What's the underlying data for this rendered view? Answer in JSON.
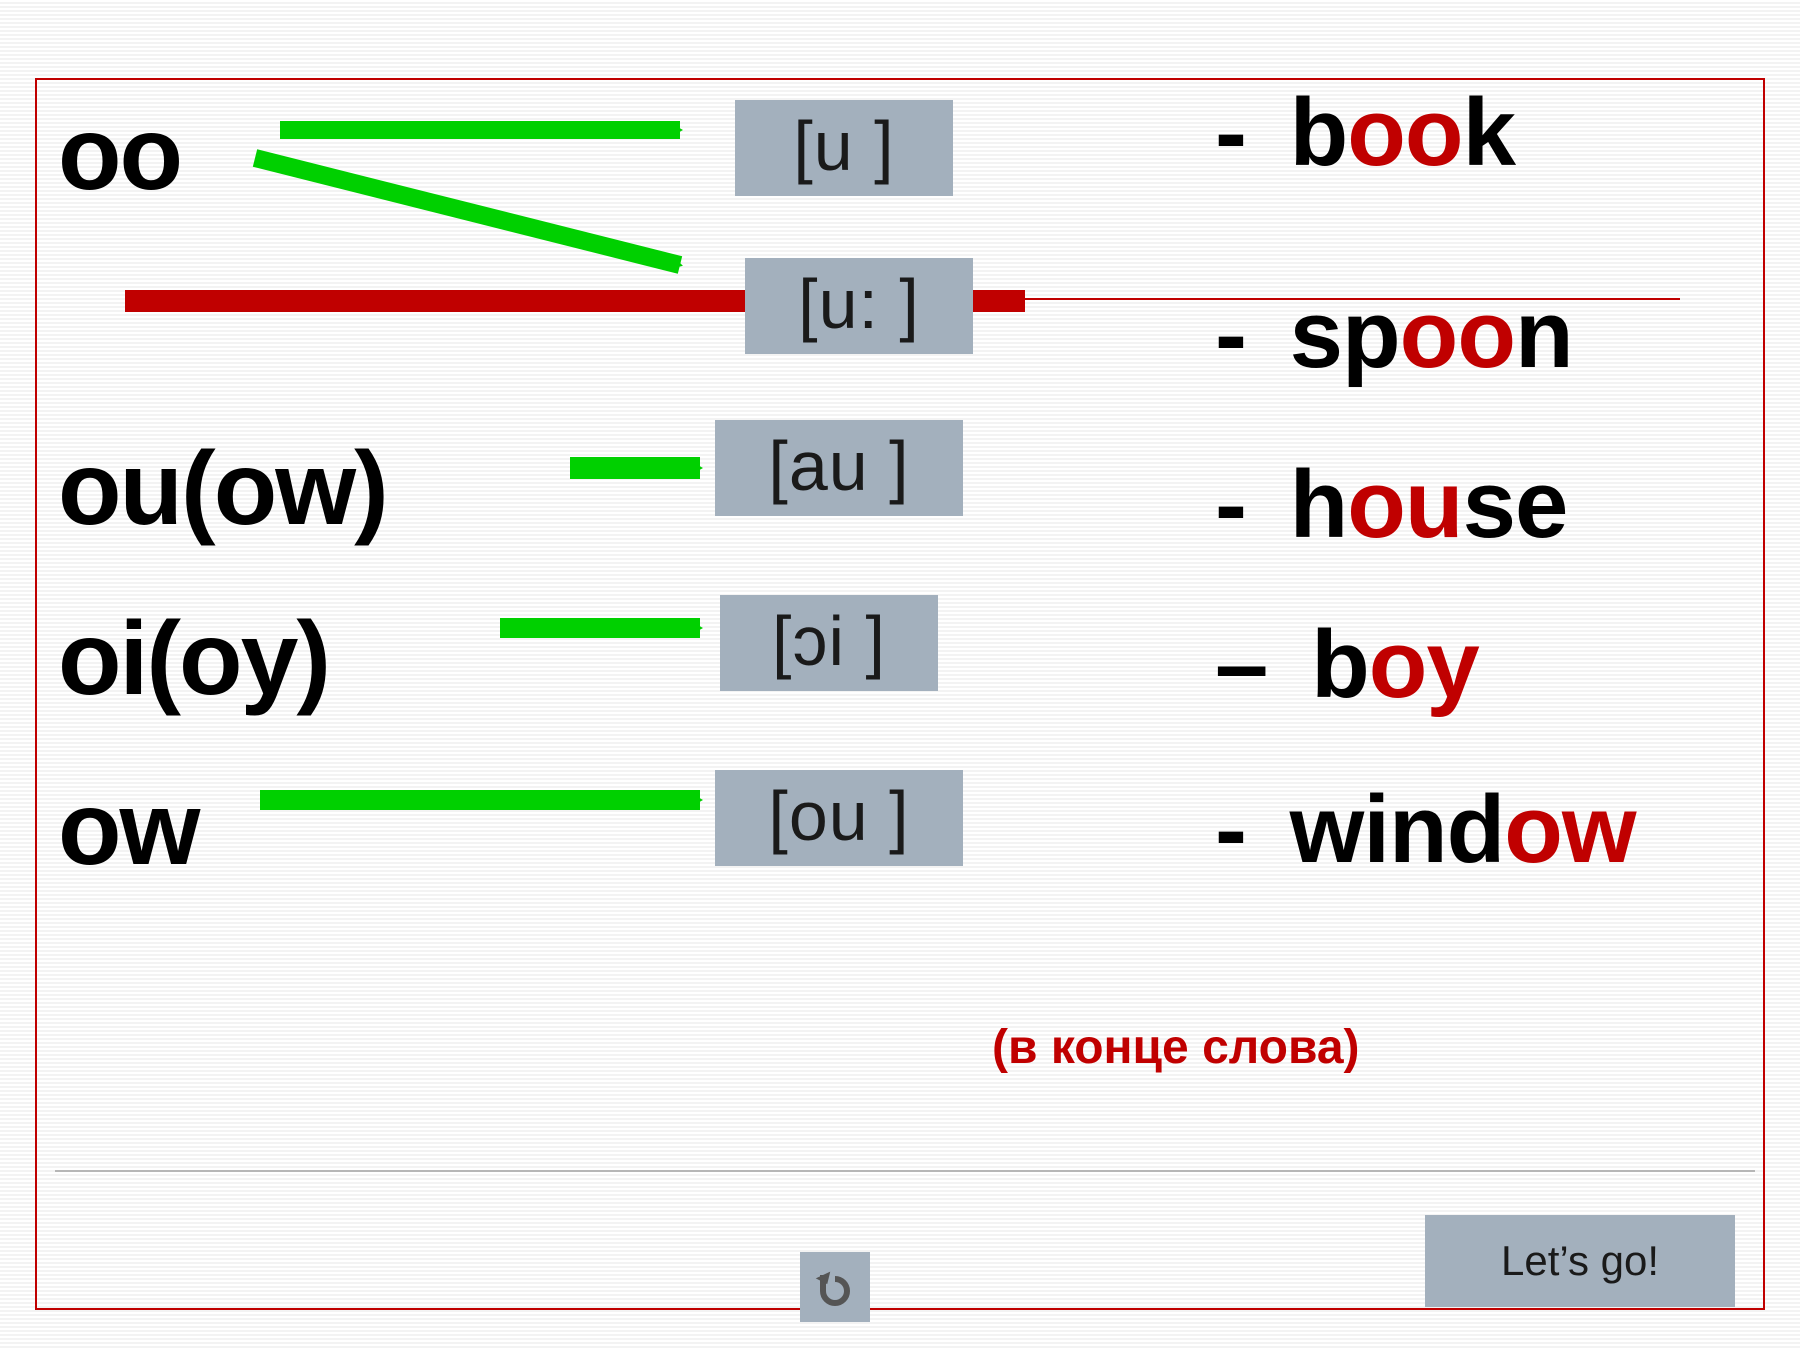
{
  "combos": {
    "oo": "oo",
    "ou_ow": "ou(ow)",
    "oi_oy": "oi(oy)",
    "ow": "ow"
  },
  "phonetics": {
    "u": "[u ]",
    "u_long": "[u: ]",
    "au": "[au ]",
    "oi": "[ɔi ]",
    "ou": "[ou ]"
  },
  "examples": {
    "book": {
      "dash": "- ",
      "pre": "b",
      "hl": "oo",
      "post": "k"
    },
    "spoon": {
      "dash": "- ",
      "pre": "sp",
      "hl": "oo",
      "post": "n"
    },
    "house": {
      "dash": "- ",
      "pre": "h",
      "hl": "ou",
      "post": "se"
    },
    "boy": {
      "dash": "– ",
      "pre": "b",
      "hl": "oy",
      "post": ""
    },
    "window": {
      "dash": "- ",
      "pre": "wind",
      "hl": "ow",
      "post": ""
    }
  },
  "note": "(в конце слова)",
  "lets_go": "Let’s go!",
  "back_icon_glyph": "↻"
}
